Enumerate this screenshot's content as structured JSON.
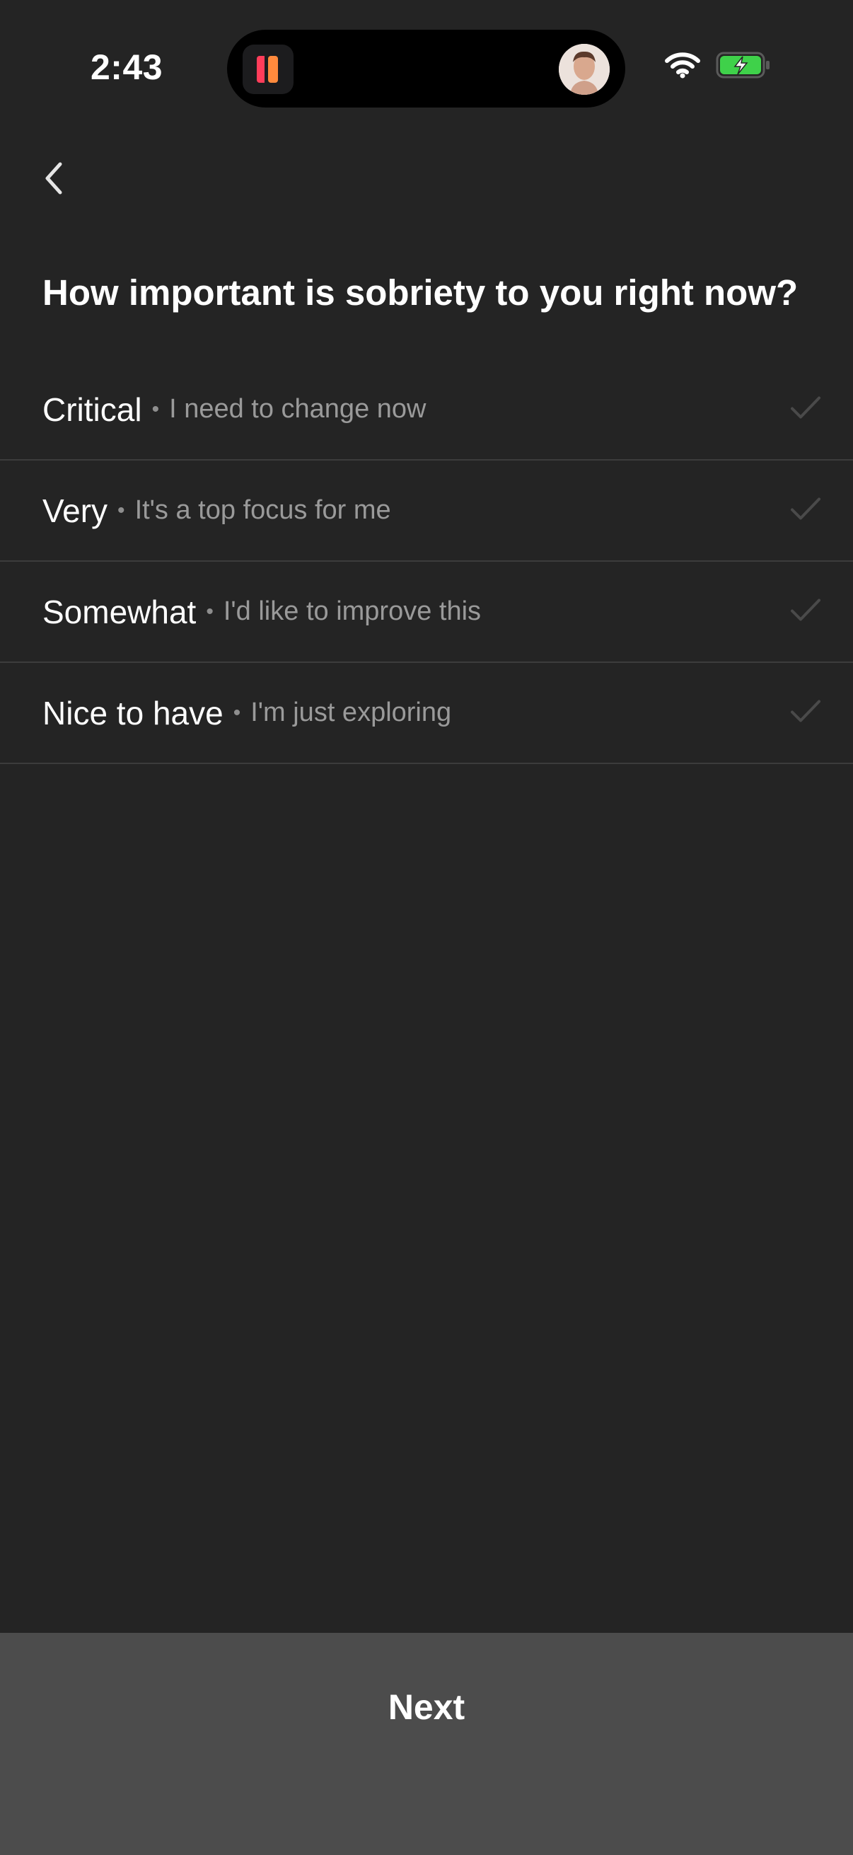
{
  "status_bar": {
    "time": "2:43",
    "icons": [
      "app-icon",
      "avatar",
      "wifi-icon",
      "battery-charging-icon"
    ],
    "battery_color": "#3fd14a"
  },
  "header": {
    "back_icon": "chevron-left-icon"
  },
  "question": "How important is sobriety to you right now?",
  "options": [
    {
      "title": "Critical",
      "separator": "•",
      "subtitle": "I need to change now"
    },
    {
      "title": "Very",
      "separator": "•",
      "subtitle": "It's a top focus for me"
    },
    {
      "title": "Somewhat",
      "separator": "•",
      "subtitle": "I'd like to improve this"
    },
    {
      "title": "Nice to have",
      "separator": "•",
      "subtitle": "I'm just exploring"
    }
  ],
  "footer": {
    "next_label": "Next"
  }
}
